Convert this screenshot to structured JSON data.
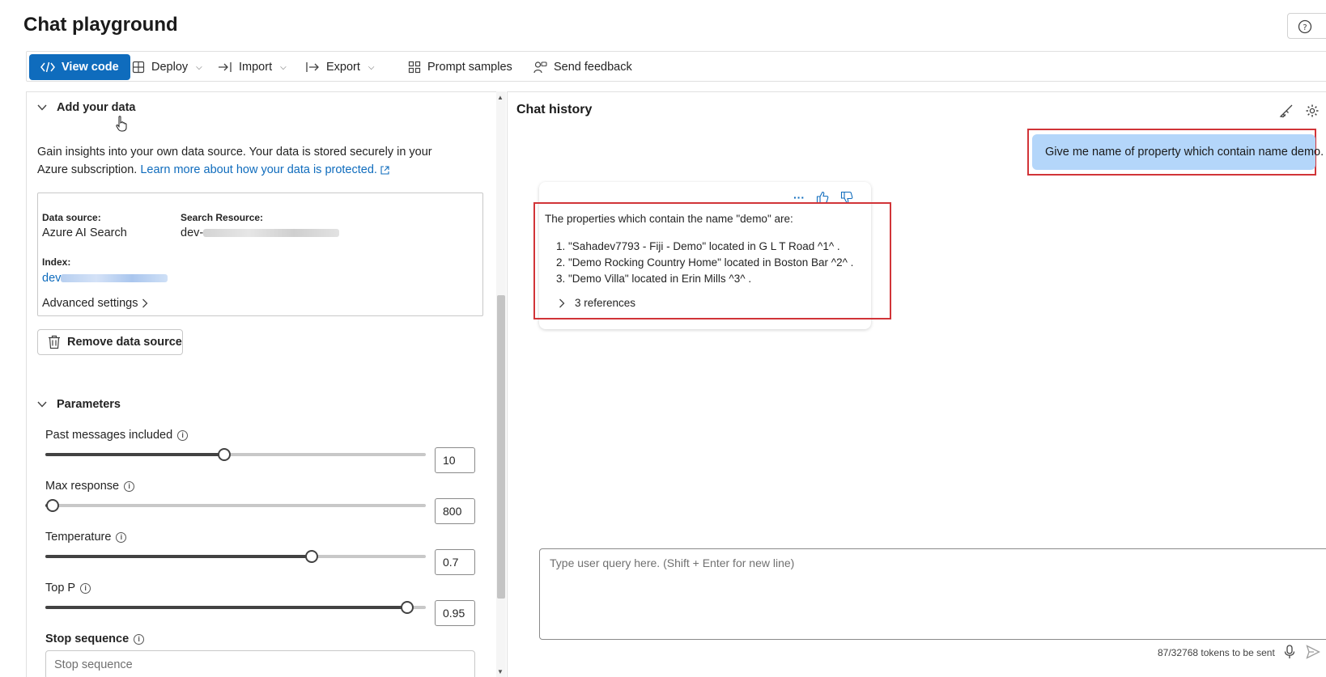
{
  "page": {
    "title": "Chat playground",
    "help_label": "H"
  },
  "toolbar": {
    "view_code": "View code",
    "deploy": "Deploy",
    "import": "Import",
    "export": "Export",
    "prompt_samples": "Prompt samples",
    "send_feedback": "Send feedback"
  },
  "add_data": {
    "title": "Add your data",
    "description": "Gain insights into your own data source. Your data is stored securely in your Azure subscription.",
    "learn_more": "Learn more about how your data is protected.",
    "data_source_label": "Data source:",
    "data_source_value": "Azure AI Search",
    "search_resource_label": "Search Resource:",
    "search_resource_prefix": "dev-",
    "index_label": "Index:",
    "index_prefix": "dev",
    "advanced_settings": "Advanced settings",
    "remove_button": "Remove data source"
  },
  "parameters": {
    "title": "Parameters",
    "past_messages": {
      "label": "Past messages included",
      "value": "10",
      "fraction": 0.47
    },
    "max_response": {
      "label": "Max response",
      "value": "800",
      "fraction": 0.02
    },
    "temperature": {
      "label": "Temperature",
      "value": "0.7",
      "fraction": 0.7
    },
    "top_p": {
      "label": "Top P",
      "value": "0.95",
      "fraction": 0.95
    },
    "stop_sequence": {
      "label": "Stop sequence",
      "placeholder": "Stop sequence"
    }
  },
  "chat": {
    "title": "Chat history",
    "user_message": "Give me name of property which contain name demo.",
    "bot_intro": "The properties which contain the name \"demo\" are:",
    "bot_items": [
      "1. \"Sahadev7793 - Fiji - Demo\" located in G L T Road ^1^ .",
      "2. \"Demo Rocking Country Home\" located in Boston Bar ^2^ .",
      "3. \"Demo Villa\" located in Erin Mills ^3^ ."
    ],
    "references": "3 references",
    "more_actions": "···",
    "input_placeholder": "Type user query here. (Shift + Enter for new line)",
    "tokens": "87/32768 tokens to be sent"
  },
  "colors": {
    "accent": "#0f6cbd",
    "highlight": "#d13438",
    "user_bubble": "#b4d6fa"
  }
}
